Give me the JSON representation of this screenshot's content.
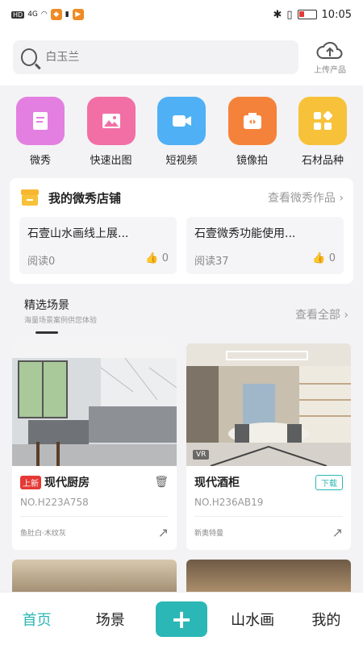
{
  "status": {
    "time": "10:05",
    "network": "4G"
  },
  "search": {
    "placeholder": "白玉兰"
  },
  "upload": {
    "label": "上传产品"
  },
  "categories": [
    {
      "label": "微秀",
      "icon": "scroll-icon",
      "color": "#e37fe0"
    },
    {
      "label": "快速出图",
      "icon": "image-icon",
      "color": "#f26fa6"
    },
    {
      "label": "短视频",
      "icon": "video-camera-icon",
      "color": "#4fb0f5"
    },
    {
      "label": "镜像拍",
      "icon": "camera-icon",
      "color": "#f5823a"
    },
    {
      "label": "石材品种",
      "icon": "grid-icon",
      "color": "#f7c23a"
    }
  ],
  "shop": {
    "title": "我的微秀店铺",
    "more": "查看微秀作品",
    "cards": [
      {
        "title": "石壹山水画线上展...",
        "reads": "阅读0",
        "likes": "0"
      },
      {
        "title": "石壹微秀功能使用...",
        "reads": "阅读37",
        "likes": "0"
      }
    ]
  },
  "scenes": {
    "title": "精选场景",
    "subtitle": "海量场景案例供您体验",
    "more": "查看全部",
    "items": [
      {
        "new_tag": "上新",
        "name": "现代厨房",
        "code": "NO.H223A758",
        "material": "鱼肚白·木纹灰",
        "badge": ""
      },
      {
        "new_tag": "",
        "name": "现代酒柜",
        "code": "NO.H236AB19",
        "material": "新奥特曼",
        "badge": "下载",
        "vr": "VR"
      }
    ]
  },
  "tabs": {
    "home": "首页",
    "scene": "场景",
    "add": "+",
    "landscape": "山水画",
    "mine": "我的"
  },
  "colors": {
    "accent": "#2bb7b5",
    "new": "#e53935"
  }
}
